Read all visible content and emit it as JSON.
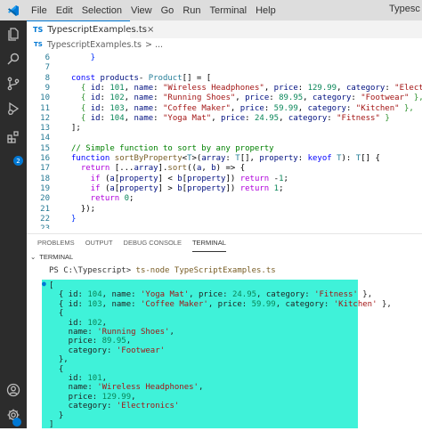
{
  "window": {
    "title": "Typesc",
    "menu": [
      "File",
      "Edit",
      "Selection",
      "View",
      "Go",
      "Run",
      "Terminal",
      "Help"
    ]
  },
  "activity_bar": {
    "icons": [
      "explorer-icon",
      "search-icon",
      "source-control-icon",
      "run-debug-icon",
      "extensions-icon",
      "account-icon",
      "settings-icon"
    ],
    "extensions_badge": "2"
  },
  "editor": {
    "tab": {
      "badge": "TS",
      "label": "TypescriptExamples.ts",
      "close": "×"
    },
    "breadcrumb": {
      "badge": "TS",
      "file": "TypescriptExamples.ts",
      "rest": "> ..."
    },
    "lines": [
      {
        "n": "6",
        "tokens": [
          [
            "br",
            "    }"
          ]
        ]
      },
      {
        "n": "7",
        "tokens": []
      },
      {
        "n": "8",
        "tokens": [
          [
            "kw",
            "const "
          ],
          [
            "var",
            "products"
          ],
          [
            "",
            "- "
          ],
          [
            "typ",
            "Product"
          ],
          [
            "",
            "[] = ["
          ]
        ]
      },
      {
        "n": "9",
        "tokens": [
          [
            "br2",
            "  { "
          ],
          [
            "var",
            "id"
          ],
          [
            "",
            ": "
          ],
          [
            "num",
            "101"
          ],
          [
            "",
            ", "
          ],
          [
            "var",
            "name"
          ],
          [
            "",
            ": "
          ],
          [
            "str",
            "\"Wireless Headphones\""
          ],
          [
            "",
            ", "
          ],
          [
            "var",
            "price"
          ],
          [
            "",
            ": "
          ],
          [
            "num",
            "129.99"
          ],
          [
            "",
            ", "
          ],
          [
            "var",
            "category"
          ],
          [
            "",
            ": "
          ],
          [
            "str",
            "\"Electronics\""
          ],
          [
            "br2",
            " },"
          ]
        ]
      },
      {
        "n": "10",
        "tokens": [
          [
            "br2",
            "  { "
          ],
          [
            "var",
            "id"
          ],
          [
            "",
            ": "
          ],
          [
            "num",
            "102"
          ],
          [
            "",
            ", "
          ],
          [
            "var",
            "name"
          ],
          [
            "",
            ": "
          ],
          [
            "str",
            "\"Running Shoes\""
          ],
          [
            "",
            ", "
          ],
          [
            "var",
            "price"
          ],
          [
            "",
            ": "
          ],
          [
            "num",
            "89.95"
          ],
          [
            "",
            ", "
          ],
          [
            "var",
            "category"
          ],
          [
            "",
            ": "
          ],
          [
            "str",
            "\"Footwear\""
          ],
          [
            "br2",
            " },"
          ]
        ]
      },
      {
        "n": "11",
        "tokens": [
          [
            "br2",
            "  { "
          ],
          [
            "var",
            "id"
          ],
          [
            "",
            ": "
          ],
          [
            "num",
            "103"
          ],
          [
            "",
            ", "
          ],
          [
            "var",
            "name"
          ],
          [
            "",
            ": "
          ],
          [
            "str",
            "\"Coffee Maker\""
          ],
          [
            "",
            ", "
          ],
          [
            "var",
            "price"
          ],
          [
            "",
            ": "
          ],
          [
            "num",
            "59.99"
          ],
          [
            "",
            ", "
          ],
          [
            "var",
            "category"
          ],
          [
            "",
            ": "
          ],
          [
            "str",
            "\"Kitchen\""
          ],
          [
            "br2",
            " },"
          ]
        ]
      },
      {
        "n": "12",
        "tokens": [
          [
            "br2",
            "  { "
          ],
          [
            "var",
            "id"
          ],
          [
            "",
            ": "
          ],
          [
            "num",
            "104"
          ],
          [
            "",
            ", "
          ],
          [
            "var",
            "name"
          ],
          [
            "",
            ": "
          ],
          [
            "str",
            "\"Yoga Mat\""
          ],
          [
            "",
            ", "
          ],
          [
            "var",
            "price"
          ],
          [
            "",
            ": "
          ],
          [
            "num",
            "24.95"
          ],
          [
            "",
            ", "
          ],
          [
            "var",
            "category"
          ],
          [
            "",
            ": "
          ],
          [
            "str",
            "\"Fitness\""
          ],
          [
            "br2",
            " }"
          ]
        ]
      },
      {
        "n": "13",
        "tokens": [
          [
            "",
            "];"
          ]
        ]
      },
      {
        "n": "14",
        "tokens": []
      },
      {
        "n": "15",
        "tokens": [
          [
            "cm",
            "// Simple function to sort by any property"
          ]
        ]
      },
      {
        "n": "16",
        "tokens": [
          [
            "kw",
            "function "
          ],
          [
            "fn",
            "sortByProperty"
          ],
          [
            "",
            "<"
          ],
          [
            "typ",
            "T"
          ],
          [
            "",
            ">("
          ],
          [
            "var",
            "array"
          ],
          [
            "",
            ": "
          ],
          [
            "typ",
            "T"
          ],
          [
            "",
            "[], "
          ],
          [
            "var",
            "property"
          ],
          [
            "",
            ": "
          ],
          [
            "kw",
            "keyof "
          ],
          [
            "typ",
            "T"
          ],
          [
            "",
            "): "
          ],
          [
            "typ",
            "T"
          ],
          [
            "",
            "[] {"
          ]
        ]
      },
      {
        "n": "17",
        "tokens": [
          [
            "kw2",
            "  return "
          ],
          [
            "",
            "[..."
          ],
          [
            "var",
            "array"
          ],
          [
            "",
            "]."
          ],
          [
            "fn",
            "sort"
          ],
          [
            "",
            "(("
          ],
          [
            "var",
            "a"
          ],
          [
            "",
            ", "
          ],
          [
            "var",
            "b"
          ],
          [
            "",
            ") => {"
          ]
        ]
      },
      {
        "n": "18",
        "tokens": [
          [
            "kw2",
            "    if "
          ],
          [
            "",
            "("
          ],
          [
            "var",
            "a"
          ],
          [
            "",
            "["
          ],
          [
            "var",
            "property"
          ],
          [
            "",
            "] < "
          ],
          [
            "var",
            "b"
          ],
          [
            "",
            "["
          ],
          [
            "var",
            "property"
          ],
          [
            "",
            "]) "
          ],
          [
            "kw2",
            "return "
          ],
          [
            "",
            "-"
          ],
          [
            "num",
            "1"
          ],
          [
            "",
            ";"
          ]
        ]
      },
      {
        "n": "19",
        "tokens": [
          [
            "kw2",
            "    if "
          ],
          [
            "",
            "("
          ],
          [
            "var",
            "a"
          ],
          [
            "",
            "["
          ],
          [
            "var",
            "property"
          ],
          [
            "",
            "] > "
          ],
          [
            "var",
            "b"
          ],
          [
            "",
            "["
          ],
          [
            "var",
            "property"
          ],
          [
            "",
            "]) "
          ],
          [
            "kw2",
            "return "
          ],
          [
            "num",
            "1"
          ],
          [
            "",
            ";"
          ]
        ]
      },
      {
        "n": "20",
        "tokens": [
          [
            "kw2",
            "    return "
          ],
          [
            "num",
            "0"
          ],
          [
            "",
            ";"
          ]
        ]
      },
      {
        "n": "21",
        "tokens": [
          [
            "",
            "  });"
          ]
        ]
      },
      {
        "n": "22",
        "tokens": [
          [
            "br",
            "}"
          ]
        ]
      },
      {
        "n": "23",
        "tokens": []
      }
    ]
  },
  "panel": {
    "tabs": [
      "PROBLEMS",
      "OUTPUT",
      "DEBUG CONSOLE",
      "TERMINAL"
    ],
    "terminal_header": "TERMINAL",
    "prompt": "PS C:\\Typescript>",
    "command": "ts-node TypeScriptExamples.ts",
    "output": [
      [
        [
          "",
          "["
        ]
      ],
      [
        [
          "",
          "  { id: "
        ],
        [
          "n",
          "104"
        ],
        [
          "",
          ", name: "
        ],
        [
          "s",
          "'Yoga Mat'"
        ],
        [
          "",
          ", price: "
        ],
        [
          "n",
          "24.95"
        ],
        [
          "",
          ", category: "
        ],
        [
          "s",
          "'Fitness'"
        ],
        [
          "",
          " },"
        ]
      ],
      [
        [
          "",
          "  { id: "
        ],
        [
          "n",
          "103"
        ],
        [
          "",
          ", name: "
        ],
        [
          "s",
          "'Coffee Maker'"
        ],
        [
          "",
          ", price: "
        ],
        [
          "n",
          "59.99"
        ],
        [
          "",
          ", category: "
        ],
        [
          "s",
          "'Kitchen'"
        ],
        [
          "",
          " },"
        ]
      ],
      [
        [
          "",
          "  {"
        ]
      ],
      [
        [
          "",
          "    id: "
        ],
        [
          "n",
          "102"
        ],
        [
          "",
          ","
        ]
      ],
      [
        [
          "",
          "    name: "
        ],
        [
          "s",
          "'Running Shoes'"
        ],
        [
          "",
          ","
        ]
      ],
      [
        [
          "",
          "    price: "
        ],
        [
          "n",
          "89.95"
        ],
        [
          "",
          ","
        ]
      ],
      [
        [
          "",
          "    category: "
        ],
        [
          "s",
          "'Footwear'"
        ]
      ],
      [
        [
          "",
          "  },"
        ]
      ],
      [
        [
          "",
          "  {"
        ]
      ],
      [
        [
          "",
          "    id: "
        ],
        [
          "n",
          "101"
        ],
        [
          "",
          ","
        ]
      ],
      [
        [
          "",
          "    name: "
        ],
        [
          "s",
          "'Wireless Headphones'"
        ],
        [
          "",
          ","
        ]
      ],
      [
        [
          "",
          "    price: "
        ],
        [
          "n",
          "129.99"
        ],
        [
          "",
          ","
        ]
      ],
      [
        [
          "",
          "    category: "
        ],
        [
          "s",
          "'Electronics'"
        ]
      ],
      [
        [
          "",
          "  }"
        ]
      ],
      [
        [
          "",
          "]"
        ]
      ]
    ]
  }
}
